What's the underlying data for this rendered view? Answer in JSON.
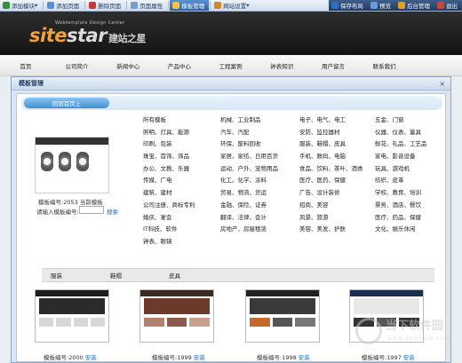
{
  "toolbar": {
    "items": [
      {
        "label": "添加模块",
        "color": "#3b8d3b"
      },
      {
        "label": "添加页面",
        "color": "#5b8fd1"
      },
      {
        "label": "删除页面",
        "color": "#c23b3b"
      },
      {
        "label": "页面属性",
        "color": "#7a9ec9"
      },
      {
        "label": "模板管理",
        "color": "#f3c242"
      },
      {
        "label": "网站设置",
        "color": "#d08a2f"
      },
      {
        "label": "保存布局",
        "color": "#2f6fbf"
      },
      {
        "label": "预览",
        "color": "#6b9ad8"
      },
      {
        "label": "后台管理",
        "color": "#e0a020"
      },
      {
        "label": "退出",
        "color": "#c94a3a"
      }
    ]
  },
  "header": {
    "logo_part1": "site",
    "logo_part2": "star",
    "logo_cn": "建站之星",
    "logo_sub": "Webtemplate Design Center"
  },
  "nav": {
    "items": [
      "首页",
      "公司简介",
      "新闻中心",
      "产品中心",
      "工程案例",
      "钟表知识",
      "用户留言",
      "联系我们"
    ]
  },
  "modal": {
    "title": "模板管理",
    "close": "×",
    "back_label": "回到首页上",
    "template_no": "模板编号:2053 当前模板",
    "input_label": "请输入模板编号:",
    "search_label": "搜索",
    "categories": [
      "所有模板",
      "机械、工业制品",
      "电子、电气、电工",
      "五金、门窗",
      "照明、灯具、能源",
      "汽车、汽配",
      "安防、监控器材",
      "仪器、仪表、量具",
      "印刷、包装",
      "环保、废料回收",
      "服装、鞋帽、皮具",
      "鲜花、礼品、工艺品",
      "珠宝、首饰、饰品",
      "家居、家纺、日用百货",
      "手机、数码、电脑",
      "家电、影音设备",
      "办公、文教、乐器",
      "运动、户外、宠物用品",
      "食品、饮料、茶叶、酒类",
      "玩具、游戏机",
      "传媒、广电",
      "化工、化学、涂料",
      "医疗、医药、保健",
      "纺织、皮革",
      "建筑、建材",
      "贸易、物流、货运",
      "广告、设计装修",
      "学校、教育、培训",
      "公司注册、商标专利",
      "金融、保险、证券",
      "招商、美容",
      "票务、酒店、餐饮",
      "婚庆、宴会",
      "翻译、法律、会计",
      "风景、旅游",
      "医疗、药品、保健",
      "IT科技、软件",
      "房地产、房屋租赁",
      "美容、美发、护肤",
      "文化、娱乐休闲",
      "钟表、眼镜",
      "",
      "",
      ""
    ],
    "tabs": [
      "服装",
      "鞋帽",
      "皮具"
    ],
    "templates": [
      {
        "caption": "模板编号:2000",
        "install": "安装"
      },
      {
        "caption": "模板编号:1999",
        "install": "安装"
      },
      {
        "caption": "模板编号:1998",
        "install": "安装"
      },
      {
        "caption": "模板编号:1997",
        "install": "安装"
      }
    ]
  },
  "watermark": {
    "text": "当下软件园",
    "url": "www.downxia.com"
  }
}
